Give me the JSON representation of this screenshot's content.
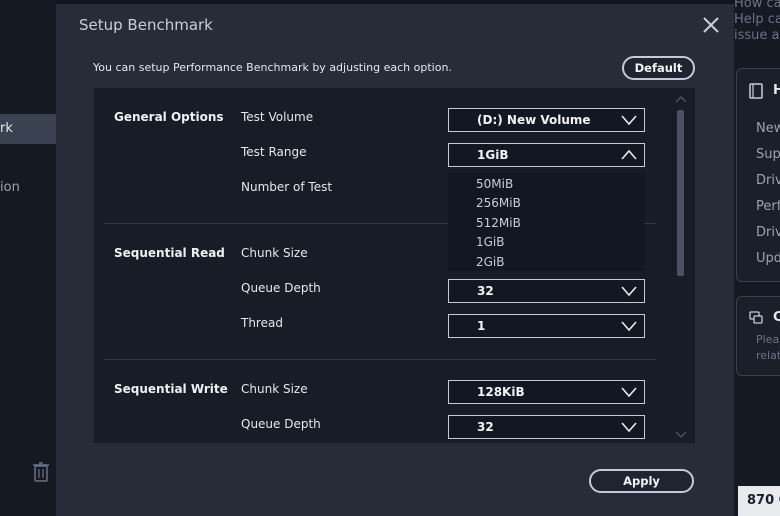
{
  "background": {
    "sidebar_left": {
      "active_item": "rk",
      "item2": "ion"
    },
    "right": {
      "top_note": [
        "How ca",
        "Help ca",
        "issue an"
      ],
      "panel1": {
        "title": "He",
        "rows": [
          "New",
          "Supp",
          "Driv",
          "Perf",
          "Driv",
          "Upd"
        ]
      },
      "panel2": {
        "title": "Cl",
        "rows": [
          "Pleas",
          "relat"
        ]
      },
      "bottom_number": "870 C"
    }
  },
  "dialog": {
    "title": "Setup Benchmark",
    "description": "You can setup Performance Benchmark by adjusting each option.",
    "default_button": "Default",
    "apply_button": "Apply",
    "sections": {
      "general": {
        "label": "General Options",
        "test_volume_label": "Test Volume",
        "test_volume_value": "(D:) New Volume",
        "test_range_label": "Test Range",
        "test_range_value": "1GiB",
        "test_range_options": [
          "50MiB",
          "256MiB",
          "512MiB",
          "1GiB",
          "2GiB"
        ],
        "number_of_test_label": "Number of Test"
      },
      "seq_read": {
        "label": "Sequential Read",
        "chunk_size_label": "Chunk Size",
        "queue_depth_label": "Queue Depth",
        "queue_depth_value": "32",
        "thread_label": "Thread",
        "thread_value": "1"
      },
      "seq_write": {
        "label": "Sequential Write",
        "chunk_size_label": "Chunk Size",
        "chunk_size_value": "128KiB",
        "queue_depth_label": "Queue Depth",
        "queue_depth_value": "32"
      }
    }
  },
  "colors": {
    "modal_bg": "#262c38",
    "content_bg": "#181c26",
    "border": "#c5cad4"
  }
}
